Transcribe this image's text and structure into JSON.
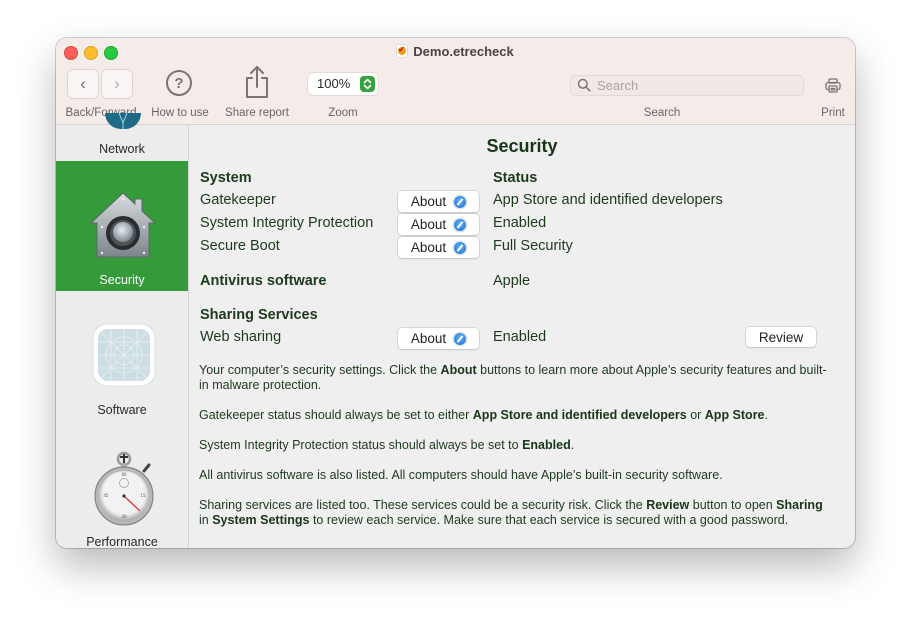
{
  "window": {
    "title": "Demo.etrecheck"
  },
  "toolbar": {
    "back_icon": "‹",
    "forward_icon": "›",
    "back_forward_label": "Back/Forward",
    "help_icon": "?",
    "how_to_use_label": "How to use",
    "share_label": "Share report",
    "zoom_value": "100%",
    "zoom_label": "Zoom",
    "search_placeholder": "Search",
    "search_label": "Search",
    "print_label": "Print"
  },
  "sidebar": {
    "items": [
      {
        "label": "Network",
        "icon": "network-globe-icon",
        "selected": false
      },
      {
        "label": "Security",
        "icon": "house-safe-icon",
        "selected": true
      },
      {
        "label": "Software",
        "icon": "app-blueprint-icon",
        "selected": false
      },
      {
        "label": "Performance",
        "icon": "stopwatch-icon",
        "selected": false
      }
    ],
    "selected_color": "#359a3a"
  },
  "main": {
    "title": "Security",
    "system_header": "System",
    "status_header": "Status",
    "system_rows": [
      {
        "name": "Gatekeeper",
        "button": "About",
        "status": "App Store and identified developers"
      },
      {
        "name": "System Integrity Protection",
        "button": "About",
        "status": "Enabled"
      },
      {
        "name": "Secure Boot",
        "button": "About",
        "status": "Full Security"
      }
    ],
    "antivirus": {
      "label": "Antivirus software",
      "value": "Apple"
    },
    "sharing_header": "Sharing Services",
    "sharing_rows": [
      {
        "name": "Web sharing",
        "button": "About",
        "status": "Enabled",
        "action": "Review"
      }
    ],
    "paragraphs": {
      "p1": {
        "a": "Your computer’s security settings. Click the ",
        "b1": "About",
        "c": " buttons to learn more about Apple’s security features and built-in malware protection."
      },
      "p2": {
        "a": "Gatekeeper status should always be set to either ",
        "b1": "App Store and identified developers",
        "c": " or ",
        "b2": "App Store",
        "d": "."
      },
      "p3": {
        "a": "System Integrity Protection status should always be set to ",
        "b1": "Enabled",
        "c": "."
      },
      "p4": {
        "a": "All antivirus software is also listed. All computers should have Apple’s built-in security software."
      },
      "p5": {
        "a": "Sharing services are listed too. These services could be a security risk. Click the ",
        "b1": "Review",
        "c": " button to open ",
        "b2": "Sharing",
        "d": " in ",
        "b3": "System Settings",
        "e": " to review each service. Make sure that each service is secured with a good password."
      }
    }
  },
  "colors": {
    "accent_green": "#359a3a",
    "text_green": "#1d3a1d",
    "titlebar_bg": "#f3ece9"
  }
}
